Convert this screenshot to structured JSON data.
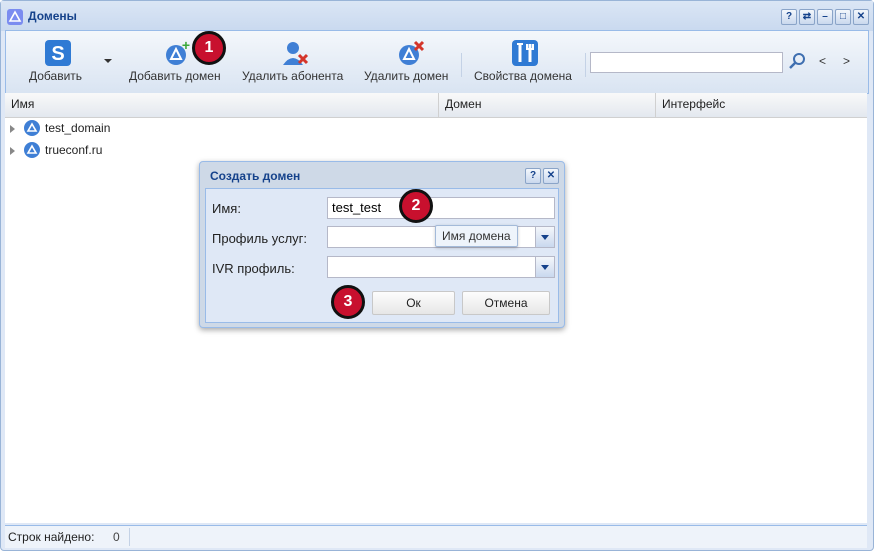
{
  "window": {
    "title": "Домены"
  },
  "toolbar": {
    "add_label": "Добавить",
    "add_domain_label": "Добавить домен",
    "remove_subscriber_label": "Удалить абонента",
    "remove_domain_label": "Удалить домен",
    "domain_properties_label": "Свойства домена",
    "nav_prev": "<",
    "nav_next": ">"
  },
  "grid": {
    "columns": [
      "Имя",
      "Домен",
      "Интерфейс"
    ],
    "rows": [
      {
        "name": "test_domain"
      },
      {
        "name": "trueconf.ru"
      }
    ]
  },
  "statusbar": {
    "label": "Строк найдено:",
    "count": "0"
  },
  "dialog": {
    "title": "Создать домен",
    "name_label": "Имя:",
    "name_value": "test_test",
    "profile_label": "Профиль услуг:",
    "profile_value": "",
    "ivr_label": "IVR профиль:",
    "ivr_value": "",
    "tooltip": "Имя домена",
    "ok_label": "Ок",
    "cancel_label": "Отмена"
  },
  "annotations": [
    "1",
    "2",
    "3"
  ],
  "colors": {
    "accent": "#15428b",
    "badge": "#c8102e"
  }
}
